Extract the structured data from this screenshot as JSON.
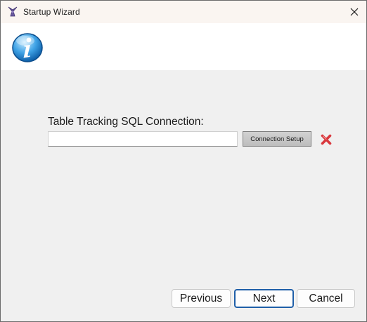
{
  "window": {
    "title": "Startup Wizard",
    "app_icon": "wizard-hat-icon",
    "close_icon": "close-icon"
  },
  "header": {
    "icon": "info-icon"
  },
  "connection": {
    "label": "Table Tracking SQL Connection:",
    "value": "",
    "setup_button_label": "Connection Setup",
    "clear_icon": "red-x-icon"
  },
  "footer": {
    "previous_label": "Previous",
    "next_label": "Next",
    "cancel_label": "Cancel"
  },
  "colors": {
    "window_bg": "#f0f0f0",
    "titlebar_bg": "#faf5f1",
    "header_bg": "#ffffff",
    "accent_focus": "#1f5fa8",
    "clear_icon": "#d9383d"
  }
}
